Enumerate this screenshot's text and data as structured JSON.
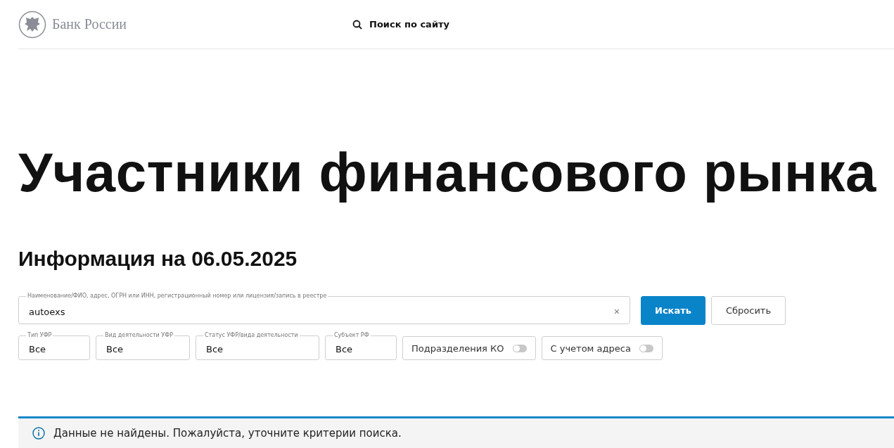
{
  "header": {
    "brand": "Банк России",
    "search_link": "Поиск по сайту"
  },
  "title": "Участники финансового рынка",
  "subtitle": "Информация на 06.05.2025",
  "search": {
    "label": "Наименование/ФИО, адрес, ОГРН или ИНН, регистрационный номер или лицензия/запись в реестре",
    "value": "autoexs",
    "clear": "×",
    "buttons": [
      {
        "label": "Искать",
        "kind": "primary"
      },
      {
        "label": "Сбросить",
        "kind": "secondary"
      }
    ]
  },
  "filters": [
    {
      "label": "Тип УФР",
      "value": "Все"
    },
    {
      "label": "Вид деятельности УФР",
      "value": "Все"
    },
    {
      "label": "Статус УФР/вида деятельности",
      "value": "Все"
    },
    {
      "label": "Субъект РФ",
      "value": "Все"
    }
  ],
  "toggles": [
    {
      "label": "Подразделения КО",
      "on": false
    },
    {
      "label": "С учетом адреса",
      "on": false
    }
  ],
  "notice": "Данные не найдены. Пожалуйста, уточните критерии поиска."
}
